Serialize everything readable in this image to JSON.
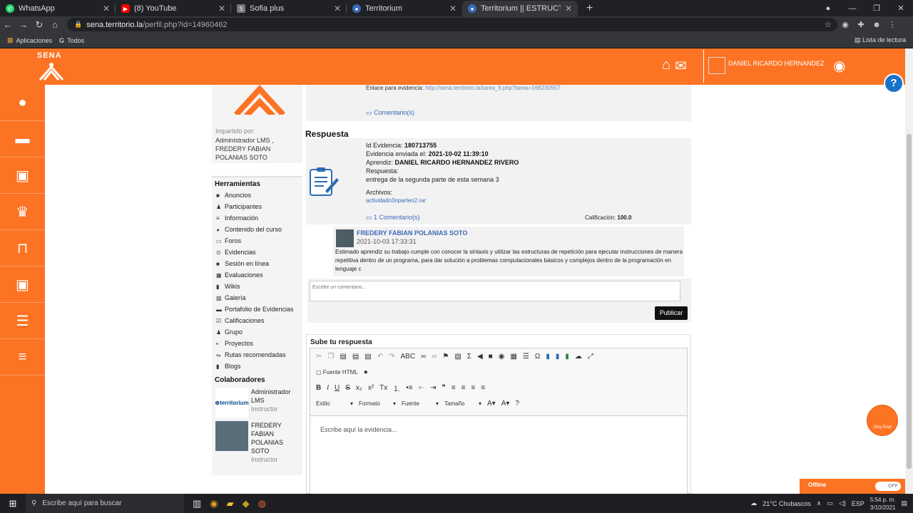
{
  "browser": {
    "tabs": [
      {
        "label": "WhatsApp",
        "icon": "whatsapp-icon",
        "color": "#25d366"
      },
      {
        "label": "(8) YouTube",
        "icon": "youtube-icon",
        "color": "#ff0000"
      },
      {
        "label": "Sofia plus",
        "icon": "sofia-icon",
        "color": "#888888"
      },
      {
        "label": "Territorium",
        "icon": "territorium-icon",
        "color": "#3a6ab8"
      },
      {
        "label": "Territorium || ESTRUCTURA DEL L",
        "icon": "territorium-icon",
        "color": "#3a6ab8",
        "active": true
      }
    ],
    "url_host": "sena.territorio.la",
    "url_path": "/perfil.php?id=14960462",
    "bookmarks": [
      "Aplicaciones",
      "Todos"
    ],
    "reading_list": "Lista de lectura"
  },
  "header": {
    "logo_text": "SENA",
    "username": "DANIEL RICARDO HERNANDEZ"
  },
  "course": {
    "imparted_by_label": "Impartido por:",
    "instructors": "Administrador LMS , FREDERY FABIAN POLANIAS SOTO"
  },
  "tools": {
    "title": "Herramientas",
    "items": [
      "Anuncios",
      "Participantes",
      "Información",
      "Contenido del curso",
      "Foros",
      "Evidencias",
      "Sesión en línea",
      "Evaluaciones",
      "Wikis",
      "Galería",
      "Portafolio de Evidencias",
      "Calificaciones",
      "Grupo",
      "Proyectos",
      "Rutas recomendadas",
      "Blogs"
    ]
  },
  "collaborators": {
    "title": "Colaboradores",
    "items": [
      {
        "name": "Administrador LMS",
        "role": "Instructor",
        "logo": "territorium"
      },
      {
        "name": "FREDERY FABIAN POLANIAS SOTO",
        "role": "Instructor"
      }
    ]
  },
  "evidence": {
    "link_label": "Enlace para evidencia:",
    "link_url": "http://sena.territorio.la/tarea_lt.php?tarea=168230557",
    "comments_label": "Comentario(s)"
  },
  "response": {
    "title": "Respuesta",
    "id_label": "Id Evidencia:",
    "id_value": "180713755",
    "sent_label": "Evidencia enviada el:",
    "sent_value": "2021-10-02 11:39:10",
    "learner_label": "Aprendiz:",
    "learner_value": "DANIEL RICARDO HERNANDEZ RIVERO",
    "answer_label": "Respuesta:",
    "answer_value": "entrega de la segunda parte de esta semana 3",
    "files_label": "Archivos:",
    "file_name": "actividadn3nparten2.rar",
    "comments_link": "1 Comentario(s)",
    "grade_label": "Calificación:",
    "grade_value": "100.0"
  },
  "comment": {
    "author": "FREDERY FABIAN POLANIAS SOTO",
    "date": "2021-10-03 17:33:31",
    "text": "Estimado aprendiz su trabajo cumple con conocer la sintaxis y utilizar las estructuras de repetición para ejecutar instrucciones de manera repetitiva dentro de un programa, para dar solución a problemas computacionales básicos y complejos dentro de la programación en lenguaje c"
  },
  "new_comment": {
    "placeholder": "Escribe un comentario...",
    "publish_label": "Publicar"
  },
  "upload": {
    "title": "Sube tu respuesta",
    "html_source_label": "Fuente HTML",
    "dropdowns": [
      "Estilo",
      "Formato",
      "Fuente",
      "Tamaño"
    ],
    "placeholder": "Escribe aquí la evidencia..."
  },
  "eva": {
    "label": "¡Soy Eva!"
  },
  "offline": {
    "label": "Offline",
    "toggle": "OFF"
  },
  "taskbar": {
    "search_placeholder": "Escribe aquí para buscar",
    "weather": "21°C  Chubascos",
    "lang": "ESP",
    "time": "5:54 p. m.",
    "date": "3/10/2021"
  },
  "colors": {
    "brand_orange": "#fc7323",
    "link_blue": "#3a6ab8"
  }
}
